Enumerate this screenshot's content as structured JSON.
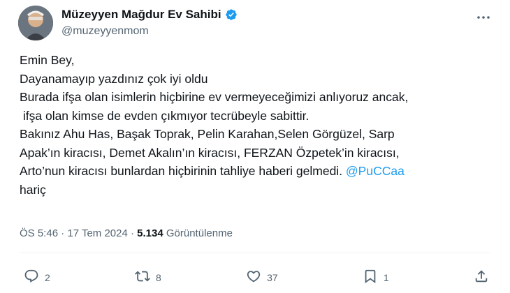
{
  "author": {
    "name": "Müzeyyen Mağdur Ev Sahibi",
    "handle": "@muzeyyenmom"
  },
  "tweet": {
    "lines": [
      "Emin Bey,",
      "Dayanamayıp yazdınız çok iyi oldu",
      "Burada ifşa olan isimlerin hiçbirine ev vermeyeceğimizi anlıyoruz ancak,",
      " ifşa olan kimse de evden çıkmıyor tecrübeyle sabittir.",
      "Bakınız Ahu Has, Başak Toprak, Pelin Karahan,Selen Görgüzel, Sarp",
      "Apak’ın kiracısı, Demet Akalın’ın kiracısı, FERZAN Özpetek’in kiracısı,",
      "Arto’nun kiracısı bunlardan hiçbirinin tahliye haberi gelmedi. "
    ],
    "mention": "@PuCCaa",
    "last_line": "hariç"
  },
  "meta": {
    "time_date": "ÖS 5:46 · 17 Tem 2024 · ",
    "views_count": "5.134",
    "views_label": " Görüntülenme"
  },
  "actions": {
    "reply_count": "2",
    "retweet_count": "8",
    "like_count": "37",
    "bookmark_count": "1"
  },
  "colors": {
    "accent": "#1d9bf0",
    "text": "#0f1419",
    "secondary": "#536471"
  },
  "icons": {
    "verified": "verified-badge-icon",
    "more": "more-icon",
    "reply": "reply-icon",
    "retweet": "retweet-icon",
    "like": "heart-icon",
    "bookmark": "bookmark-icon",
    "share": "share-icon"
  }
}
